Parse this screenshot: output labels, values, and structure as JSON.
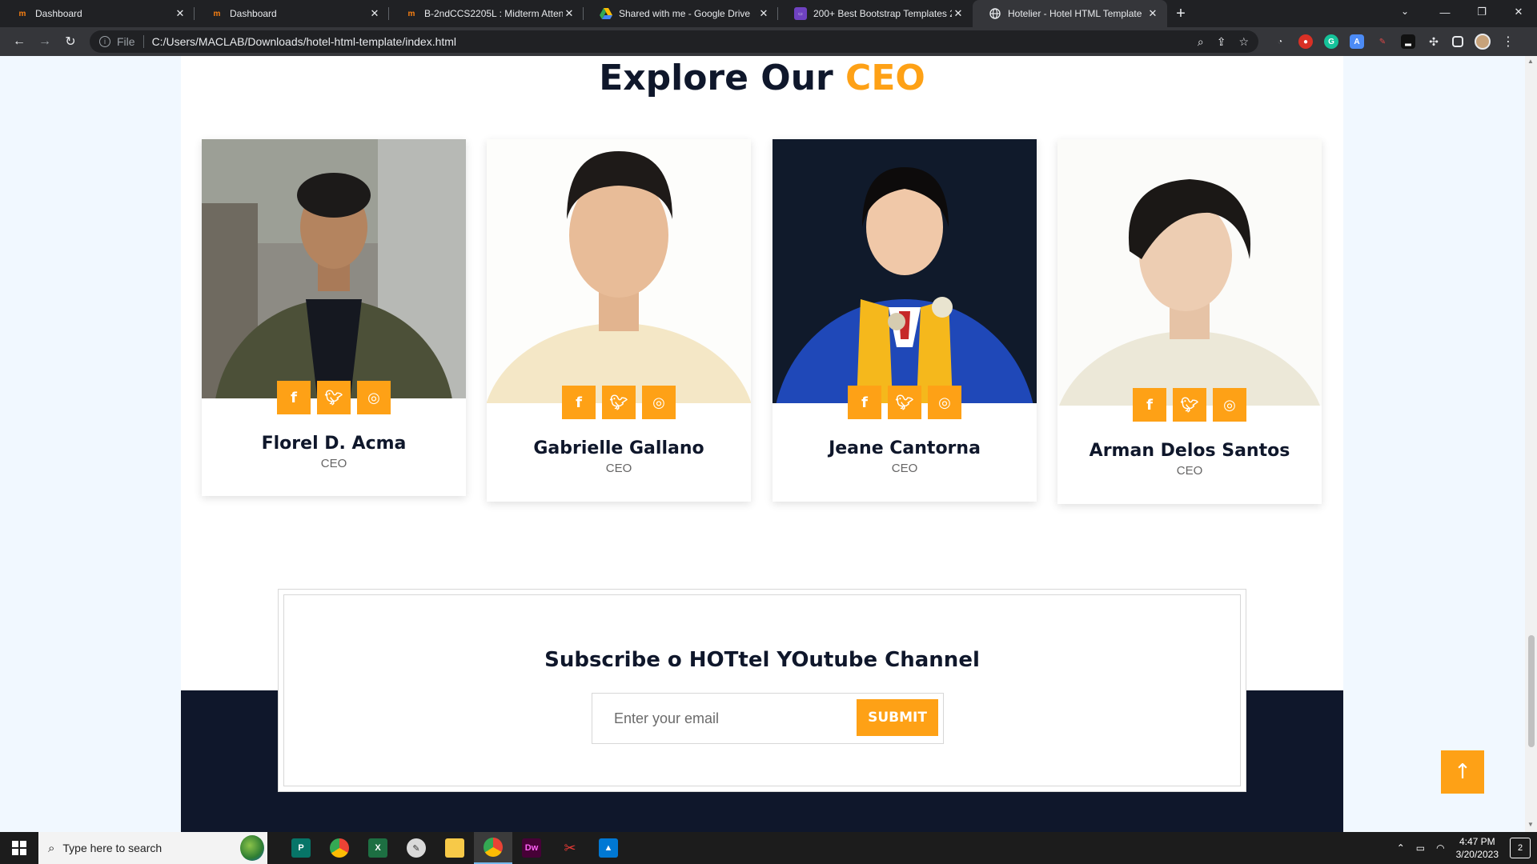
{
  "browser": {
    "tabs": [
      {
        "title": "Dashboard",
        "favicon": "m"
      },
      {
        "title": "Dashboard",
        "favicon": "m"
      },
      {
        "title": "B-2ndCCS2205L : Midterm Atten",
        "favicon": "m"
      },
      {
        "title": "Shared with me - Google Drive",
        "favicon": "drive"
      },
      {
        "title": "200+ Best Bootstrap Templates 2",
        "favicon": "doc"
      },
      {
        "title": "Hotelier - Hotel HTML Template",
        "favicon": "globe",
        "active": true
      }
    ],
    "new_tab_label": "+",
    "address": {
      "scheme": "File",
      "url": "C:/Users/MACLAB/Downloads/hotel-html-template/index.html"
    }
  },
  "page": {
    "team_title": {
      "main": "Explore Our",
      "accent": "CEO"
    },
    "team": [
      {
        "name": "Florel D. Acma",
        "role": "CEO"
      },
      {
        "name": "Gabrielle Gallano",
        "role": "CEO"
      },
      {
        "name": "Jeane Cantorna",
        "role": "CEO"
      },
      {
        "name": "Arman Delos Santos",
        "role": "CEO"
      }
    ],
    "social_icons": [
      "f",
      "t",
      "ig"
    ],
    "newsletter": {
      "title": "Subscribe o HOTtel YOutube Channel",
      "placeholder": "Enter your email",
      "button_label": "SUBMIT"
    },
    "back_to_top": "↑"
  },
  "taskbar": {
    "search_placeholder": "Type here to search",
    "time": "4:47 PM",
    "date": "3/20/2023",
    "notification_count": "2"
  },
  "colors": {
    "accent": "#fea116",
    "dark": "#0f172b"
  }
}
